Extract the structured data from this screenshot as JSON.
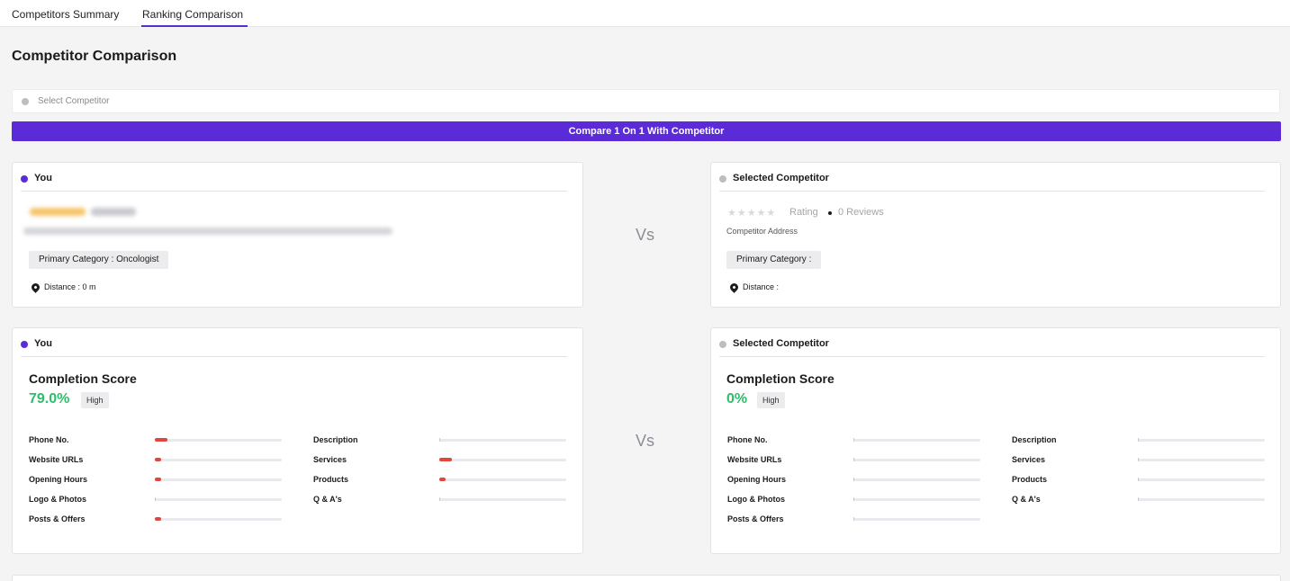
{
  "tabs": [
    {
      "label": "Competitors Summary",
      "active": false
    },
    {
      "label": "Ranking Comparison",
      "active": true
    }
  ],
  "page_title": "Competitor Comparison",
  "select": {
    "placeholder": "Select Competitor"
  },
  "compare_button": "Compare 1 On 1 With Competitor",
  "vs_label": "Vs",
  "colors": {
    "accent": "#5b2bd8",
    "score_green": "#2ebd6b",
    "bar_red": "#e0453e"
  },
  "you_profile": {
    "header": "You",
    "primary_category": "Primary Category : Oncologist",
    "distance": "Distance : 0 m"
  },
  "competitor_profile": {
    "header": "Selected Competitor",
    "stars": "★★★★★",
    "rating_label": "Rating",
    "reviews": "0 Reviews",
    "address": "Competitor Address",
    "primary_category": "Primary Category :",
    "distance": "Distance :"
  },
  "you_score": {
    "header": "You",
    "title": "Completion Score",
    "value": "79.0%",
    "level": "High",
    "metrics_left": [
      {
        "label": "Phone No.",
        "fill": 0.1
      },
      {
        "label": "Website URLs",
        "fill": 0.05
      },
      {
        "label": "Opening Hours",
        "fill": 0.05
      },
      {
        "label": "Logo & Photos",
        "fill": 0.0
      },
      {
        "label": "Posts & Offers",
        "fill": 0.05
      }
    ],
    "metrics_right": [
      {
        "label": "Description",
        "fill": 0.0
      },
      {
        "label": "Services",
        "fill": 0.1
      },
      {
        "label": "Products",
        "fill": 0.05
      },
      {
        "label": "Q & A's",
        "fill": 0.0
      }
    ]
  },
  "competitor_score": {
    "header": "Selected Competitor",
    "title": "Completion Score",
    "value": "0%",
    "level": "High",
    "metrics_left": [
      {
        "label": "Phone No.",
        "fill": 0.0
      },
      {
        "label": "Website URLs",
        "fill": 0.0
      },
      {
        "label": "Opening Hours",
        "fill": 0.0
      },
      {
        "label": "Logo & Photos",
        "fill": 0.0
      },
      {
        "label": "Posts & Offers",
        "fill": 0.0
      }
    ],
    "metrics_right": [
      {
        "label": "Description",
        "fill": 0.0
      },
      {
        "label": "Services",
        "fill": 0.0
      },
      {
        "label": "Products",
        "fill": 0.0
      },
      {
        "label": "Q & A's",
        "fill": 0.0
      }
    ]
  }
}
